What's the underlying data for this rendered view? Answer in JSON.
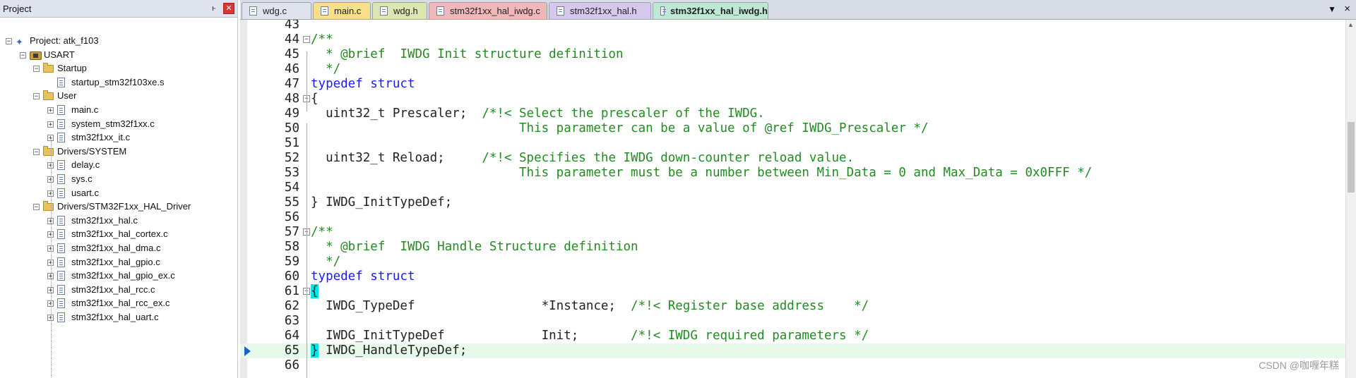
{
  "project_panel": {
    "title": "Project",
    "pin_glyph": "ͱ",
    "close_glyph": "✕",
    "tree": [
      {
        "label": "Project: atk_f103",
        "icon": "project-icon",
        "level": 0,
        "expander": "−"
      },
      {
        "label": "USART",
        "icon": "target-icon",
        "level": 1,
        "expander": "−"
      },
      {
        "label": "Startup",
        "icon": "folder-icon",
        "level": 2,
        "expander": "−"
      },
      {
        "label": "startup_stm32f103xe.s",
        "icon": "file-icon",
        "level": 3,
        "expander": ""
      },
      {
        "label": "User",
        "icon": "folder-icon",
        "level": 2,
        "expander": "−"
      },
      {
        "label": "main.c",
        "icon": "file-icon",
        "level": 3,
        "expander": "+"
      },
      {
        "label": "system_stm32f1xx.c",
        "icon": "file-icon",
        "level": 3,
        "expander": "+"
      },
      {
        "label": "stm32f1xx_it.c",
        "icon": "file-icon",
        "level": 3,
        "expander": "+"
      },
      {
        "label": "Drivers/SYSTEM",
        "icon": "folder-icon",
        "level": 2,
        "expander": "−"
      },
      {
        "label": "delay.c",
        "icon": "file-icon",
        "level": 3,
        "expander": "+"
      },
      {
        "label": "sys.c",
        "icon": "file-icon",
        "level": 3,
        "expander": "+"
      },
      {
        "label": "usart.c",
        "icon": "file-icon",
        "level": 3,
        "expander": "+"
      },
      {
        "label": "Drivers/STM32F1xx_HAL_Driver",
        "icon": "folder-icon",
        "level": 2,
        "expander": "−"
      },
      {
        "label": "stm32f1xx_hal.c",
        "icon": "file-icon",
        "level": 3,
        "expander": "+"
      },
      {
        "label": "stm32f1xx_hal_cortex.c",
        "icon": "file-icon",
        "level": 3,
        "expander": "+"
      },
      {
        "label": "stm32f1xx_hal_dma.c",
        "icon": "file-icon",
        "level": 3,
        "expander": "+"
      },
      {
        "label": "stm32f1xx_hal_gpio.c",
        "icon": "file-icon",
        "level": 3,
        "expander": "+"
      },
      {
        "label": "stm32f1xx_hal_gpio_ex.c",
        "icon": "file-icon",
        "level": 3,
        "expander": "+"
      },
      {
        "label": "stm32f1xx_hal_rcc.c",
        "icon": "file-icon",
        "level": 3,
        "expander": "+"
      },
      {
        "label": "stm32f1xx_hal_rcc_ex.c",
        "icon": "file-icon",
        "level": 3,
        "expander": "+"
      },
      {
        "label": "stm32f1xx_hal_uart.c",
        "icon": "file-icon",
        "level": 3,
        "expander": "+"
      }
    ]
  },
  "tabs": [
    {
      "label": "wdg.c",
      "color": "#dfe4ee",
      "active": false
    },
    {
      "label": "main.c",
      "color": "#f6e08a",
      "active": false
    },
    {
      "label": "wdg.h",
      "color": "#dde6b0",
      "active": false
    },
    {
      "label": "stm32f1xx_hal_iwdg.c",
      "color": "#f0b8b8",
      "active": false
    },
    {
      "label": "stm32f1xx_hal.h",
      "color": "#d6c8ec",
      "active": false
    },
    {
      "label": "stm32f1xx_hal_iwdg.h",
      "color": "#bfe8d4",
      "active": true
    }
  ],
  "tab_dropdown_glyph": "▼",
  "tab_close_glyph": "×",
  "editor": {
    "current_line": 65,
    "lines": [
      {
        "num": "43",
        "fold": "",
        "parts": []
      },
      {
        "num": "44",
        "fold": "−",
        "parts": [
          {
            "t": "/**",
            "c": "cm"
          }
        ]
      },
      {
        "num": "45",
        "fold": "",
        "parts": [
          {
            "t": "  * @brief  IWDG Init structure definition",
            "c": "cm"
          }
        ]
      },
      {
        "num": "46",
        "fold": "",
        "parts": [
          {
            "t": "  */",
            "c": "cm"
          }
        ]
      },
      {
        "num": "47",
        "fold": "",
        "parts": [
          {
            "t": "typedef struct",
            "c": "kw"
          }
        ]
      },
      {
        "num": "48",
        "fold": "−",
        "parts": [
          {
            "t": "{",
            "c": ""
          }
        ]
      },
      {
        "num": "49",
        "fold": "",
        "parts": [
          {
            "t": "  uint32_t Prescaler;  ",
            "c": ""
          },
          {
            "t": "/*!< Select the prescaler of the IWDG.",
            "c": "cm"
          }
        ]
      },
      {
        "num": "50",
        "fold": "",
        "parts": [
          {
            "t": "                            This parameter can be a value of @ref IWDG_Prescaler */",
            "c": "cm"
          }
        ]
      },
      {
        "num": "51",
        "fold": "",
        "parts": []
      },
      {
        "num": "52",
        "fold": "",
        "parts": [
          {
            "t": "  uint32_t Reload;     ",
            "c": ""
          },
          {
            "t": "/*!< Specifies the IWDG down-counter reload value.",
            "c": "cm"
          }
        ]
      },
      {
        "num": "53",
        "fold": "",
        "parts": [
          {
            "t": "                            This parameter must be a number between Min_Data = 0 and Max_Data = 0x0FFF */",
            "c": "cm"
          }
        ]
      },
      {
        "num": "54",
        "fold": "",
        "parts": []
      },
      {
        "num": "55",
        "fold": "",
        "parts": [
          {
            "t": "} IWDG_InitTypeDef;",
            "c": ""
          }
        ]
      },
      {
        "num": "56",
        "fold": "",
        "parts": []
      },
      {
        "num": "57",
        "fold": "−",
        "parts": [
          {
            "t": "/**",
            "c": "cm"
          }
        ]
      },
      {
        "num": "58",
        "fold": "",
        "parts": [
          {
            "t": "  * @brief  IWDG Handle Structure definition",
            "c": "cm"
          }
        ]
      },
      {
        "num": "59",
        "fold": "",
        "parts": [
          {
            "t": "  */",
            "c": "cm"
          }
        ]
      },
      {
        "num": "60",
        "fold": "",
        "parts": [
          {
            "t": "typedef struct",
            "c": "kw"
          }
        ]
      },
      {
        "num": "61",
        "fold": "−",
        "parts": [
          {
            "t": "{",
            "c": "brace-hl"
          }
        ]
      },
      {
        "num": "62",
        "fold": "",
        "parts": [
          {
            "t": "  IWDG_TypeDef                 *Instance;  ",
            "c": ""
          },
          {
            "t": "/*!< Register base address    */",
            "c": "cm"
          }
        ]
      },
      {
        "num": "63",
        "fold": "",
        "parts": []
      },
      {
        "num": "64",
        "fold": "",
        "parts": [
          {
            "t": "  IWDG_InitTypeDef             Init;       ",
            "c": ""
          },
          {
            "t": "/*!< IWDG required parameters */",
            "c": "cm"
          }
        ]
      },
      {
        "num": "65",
        "fold": "",
        "parts": [
          {
            "t": "}",
            "c": "brace-hl"
          },
          {
            "t": " IWDG_HandleTypeDef;",
            "c": ""
          }
        ]
      },
      {
        "num": "66",
        "fold": "",
        "parts": []
      }
    ]
  },
  "watermark": "CSDN @咖喱年糕",
  "scroll_up_glyph": "▲"
}
